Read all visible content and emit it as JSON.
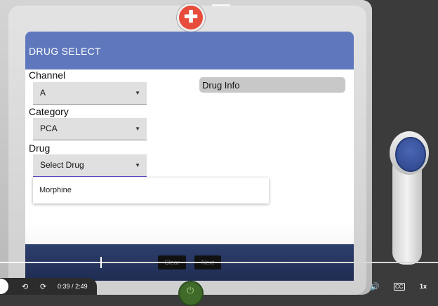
{
  "screen": {
    "title": "DRUG SELECT",
    "channel": {
      "label": "Channel",
      "value": "A"
    },
    "category": {
      "label": "Category",
      "value": "PCA"
    },
    "drug": {
      "label": "Drug",
      "value": "Select Drug"
    },
    "drug_options": [
      "Morphine"
    ],
    "drug_info_label": "Drug Info",
    "buttons": {
      "clear": "Clear",
      "next": "Next"
    }
  },
  "video": {
    "time_current": "0:39",
    "time_total": "2:49",
    "time_separator": "/",
    "speed": "1x",
    "captions_label": "CC",
    "progress_fraction": 0.2308
  },
  "colors": {
    "titlebar": "#5f78bd",
    "bottombar": "#2d3f6d",
    "logo": "#e74c3c"
  },
  "icons": [
    "medical-cross-icon",
    "caret-down-icon",
    "power-icon",
    "rewind-10-icon",
    "forward-10-icon",
    "volume-icon",
    "captions-icon",
    "handset-button-icon"
  ]
}
